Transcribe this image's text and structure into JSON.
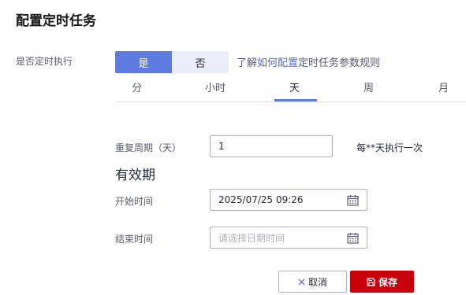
{
  "dialog": {
    "title": "配置定时任务"
  },
  "schedule": {
    "label": "是否定时执行",
    "yes_label": "是",
    "no_label": "否",
    "hint_prefix": "了解",
    "hint_link": "如何配置",
    "hint_suffix": "定时任务参数规则"
  },
  "tabs": [
    {
      "label": "分"
    },
    {
      "label": "小时"
    },
    {
      "label": "天"
    },
    {
      "label": "周"
    },
    {
      "label": "月"
    }
  ],
  "active_tab": "天",
  "repeat": {
    "label": "重复周期（天）",
    "value": "1",
    "note": "每**天执行一次"
  },
  "validity": {
    "section_title": "有效期",
    "start_label": "开始时间",
    "start_value": "2025/07/25 09:26",
    "end_label": "结束时间",
    "end_placeholder": "请选择日期时间"
  },
  "footer": {
    "cancel_label": "取消",
    "save_label": "保存"
  },
  "colors": {
    "accent": "#5e7ce0",
    "link": "#526ecc",
    "danger": "#c7000b"
  },
  "icons": {
    "calendar": "calendar-icon",
    "cancel": "close-icon",
    "save": "save-icon"
  }
}
